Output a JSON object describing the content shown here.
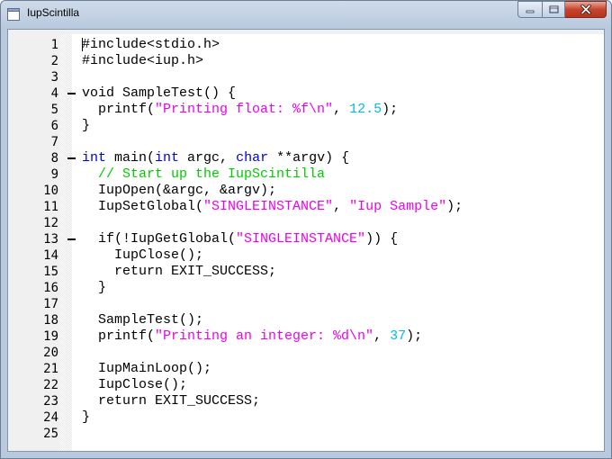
{
  "window": {
    "title": "IupScintilla"
  },
  "editor": {
    "lines": [
      {
        "n": "1",
        "fold": false,
        "tokens": [
          {
            "t": "#include<stdio.h>",
            "c": "plain"
          }
        ]
      },
      {
        "n": "2",
        "fold": false,
        "tokens": [
          {
            "t": "#include<iup.h>",
            "c": "plain"
          }
        ]
      },
      {
        "n": "3",
        "fold": false,
        "tokens": []
      },
      {
        "n": "4",
        "fold": true,
        "tokens": [
          {
            "t": "void SampleTest() {",
            "c": "plain"
          }
        ]
      },
      {
        "n": "5",
        "fold": false,
        "tokens": [
          {
            "t": "  printf(",
            "c": "plain"
          },
          {
            "t": "\"Printing float: %f\\n\"",
            "c": "str"
          },
          {
            "t": ", ",
            "c": "plain"
          },
          {
            "t": "12.5",
            "c": "num"
          },
          {
            "t": ");",
            "c": "plain"
          }
        ]
      },
      {
        "n": "6",
        "fold": false,
        "tokens": [
          {
            "t": "}",
            "c": "plain"
          }
        ]
      },
      {
        "n": "7",
        "fold": false,
        "tokens": []
      },
      {
        "n": "8",
        "fold": true,
        "tokens": [
          {
            "t": "int",
            "c": "kw"
          },
          {
            "t": " main(",
            "c": "plain"
          },
          {
            "t": "int",
            "c": "kw"
          },
          {
            "t": " argc, ",
            "c": "plain"
          },
          {
            "t": "char",
            "c": "kw"
          },
          {
            "t": " **argv) {",
            "c": "plain"
          }
        ]
      },
      {
        "n": "9",
        "fold": false,
        "tokens": [
          {
            "t": "  ",
            "c": "plain"
          },
          {
            "t": "// Start up the IupScintilla",
            "c": "cmt"
          }
        ]
      },
      {
        "n": "10",
        "fold": false,
        "tokens": [
          {
            "t": "  IupOpen(&argc, &argv);",
            "c": "plain"
          }
        ]
      },
      {
        "n": "11",
        "fold": false,
        "tokens": [
          {
            "t": "  IupSetGlobal(",
            "c": "plain"
          },
          {
            "t": "\"SINGLEINSTANCE\"",
            "c": "str"
          },
          {
            "t": ", ",
            "c": "plain"
          },
          {
            "t": "\"Iup Sample\"",
            "c": "str"
          },
          {
            "t": ");",
            "c": "plain"
          }
        ]
      },
      {
        "n": "12",
        "fold": false,
        "tokens": []
      },
      {
        "n": "13",
        "fold": true,
        "tokens": [
          {
            "t": "  if(!IupGetGlobal(",
            "c": "plain"
          },
          {
            "t": "\"SINGLEINSTANCE\"",
            "c": "str"
          },
          {
            "t": ")) {",
            "c": "plain"
          }
        ]
      },
      {
        "n": "14",
        "fold": false,
        "tokens": [
          {
            "t": "    IupClose();",
            "c": "plain"
          }
        ]
      },
      {
        "n": "15",
        "fold": false,
        "tokens": [
          {
            "t": "    return EXIT_SUCCESS;",
            "c": "plain"
          }
        ]
      },
      {
        "n": "16",
        "fold": false,
        "tokens": [
          {
            "t": "  }",
            "c": "plain"
          }
        ]
      },
      {
        "n": "17",
        "fold": false,
        "tokens": []
      },
      {
        "n": "18",
        "fold": false,
        "tokens": [
          {
            "t": "  SampleTest();",
            "c": "plain"
          }
        ]
      },
      {
        "n": "19",
        "fold": false,
        "tokens": [
          {
            "t": "  printf(",
            "c": "plain"
          },
          {
            "t": "\"Printing an integer: %d\\n\"",
            "c": "str"
          },
          {
            "t": ", ",
            "c": "plain"
          },
          {
            "t": "37",
            "c": "num"
          },
          {
            "t": ");",
            "c": "plain"
          }
        ]
      },
      {
        "n": "20",
        "fold": false,
        "tokens": []
      },
      {
        "n": "21",
        "fold": false,
        "tokens": [
          {
            "t": "  IupMainLoop();",
            "c": "plain"
          }
        ]
      },
      {
        "n": "22",
        "fold": false,
        "tokens": [
          {
            "t": "  IupClose();",
            "c": "plain"
          }
        ]
      },
      {
        "n": "23",
        "fold": false,
        "tokens": [
          {
            "t": "  return EXIT_SUCCESS;",
            "c": "plain"
          }
        ]
      },
      {
        "n": "24",
        "fold": false,
        "tokens": [
          {
            "t": "}",
            "c": "plain"
          }
        ]
      },
      {
        "n": "25",
        "fold": false,
        "tokens": []
      }
    ]
  }
}
